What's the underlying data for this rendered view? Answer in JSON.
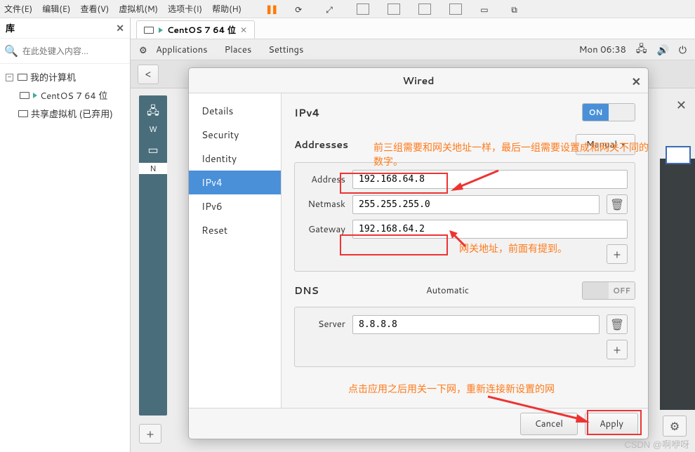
{
  "host_menu": {
    "items": [
      "文件(E)",
      "编辑(E)",
      "查看(V)",
      "虚拟机(M)",
      "选项卡(I)",
      "帮助(H)"
    ]
  },
  "sidebar": {
    "title": "库",
    "search_placeholder": "在此处键入内容...",
    "tree": {
      "root": "我的计算机",
      "vm": "CentOS 7 64 位",
      "shared": "共享虚拟机 (已弃用)"
    }
  },
  "vm_tab": {
    "label": "CentOS 7 64 位"
  },
  "gnome": {
    "menus": [
      "Applications",
      "Places",
      "Settings"
    ],
    "clock": "Mon 06:38"
  },
  "dialog": {
    "title": "Wired",
    "sidebar_items": [
      "Details",
      "Security",
      "Identity",
      "IPv4",
      "IPv6",
      "Reset"
    ],
    "selected": "IPv4",
    "ipv4": {
      "heading": "IPv4",
      "toggle_on": "ON",
      "addresses_heading": "Addresses",
      "mode_button": "Manual",
      "address_label": "Address",
      "address_value": "192.168.64.8",
      "netmask_label": "Netmask",
      "netmask_value": "255.255.255.0",
      "gateway_label": "Gateway",
      "gateway_value": "192.168.64.2",
      "dns_heading": "DNS",
      "dns_auto_label": "Automatic",
      "dns_toggle_off": "OFF",
      "server_label": "Server",
      "server_value": "8.8.8.8"
    },
    "footer": {
      "cancel": "Cancel",
      "apply": "Apply"
    }
  },
  "annotations": {
    "note1": "前三组需要和网关地址一样，最后一组需要设置成和网关不同的数字。",
    "note2": "网关地址，前面有提到。",
    "note3": "点击应用之后用关一下网，重新连接新设置的网"
  },
  "watermark": "CSDN @啊咿呀"
}
